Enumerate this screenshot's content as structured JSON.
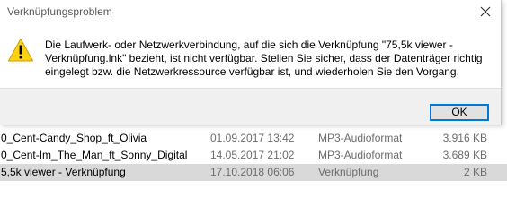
{
  "dialog": {
    "title": "Verknüpfungsproblem",
    "message_lines": [
      "Die Laufwerk- oder Netzwerkverbindung, auf die sich die Verknüpfung \"75,5k viewer -",
      "Verknüpfung.lnk\" bezieht, ist nicht verfügbar. Stellen Sie sicher, dass der Datenträger richtig",
      "eingelegt bzw. die Netzwerkressource verfügbar ist, und wiederholen Sie den Vorgang."
    ],
    "ok_label": "OK",
    "icon": "warning-icon",
    "close_icon": "close-icon"
  },
  "files": [
    {
      "name": "0_Cent-Candy_Shop_ft_Olivia",
      "date": "01.09.2017 13:42",
      "type": "MP3-Audioformat",
      "size": "3.916 KB"
    },
    {
      "name": "0_Cent-Im_The_Man_ft_Sonny_Digital",
      "date": "14.05.2017 21:02",
      "type": "MP3-Audioformat",
      "size": "3.689 KB"
    },
    {
      "name": "5,5k viewer - Verknüpfung",
      "date": "17.10.2018 06:06",
      "type": "Verknüpfung",
      "size": "2 KB"
    }
  ],
  "colors": {
    "accent": "#0078d7",
    "warning_yellow": "#fcd116",
    "selected_row": "#d9d9d9",
    "footer": "#f0f0f0"
  }
}
